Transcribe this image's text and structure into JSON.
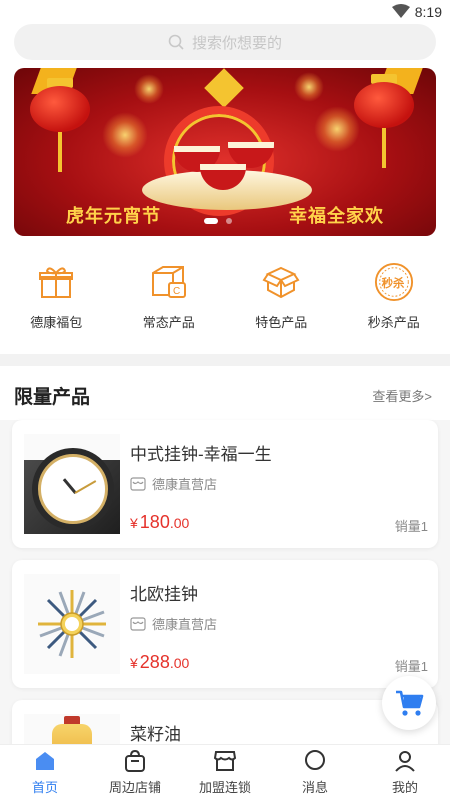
{
  "status_bar": {
    "time": "8:19"
  },
  "search": {
    "placeholder": "搜索你想要的"
  },
  "banner": {
    "caption_left": "虎年元宵节",
    "caption_right": "幸福全家欢",
    "center_glyph": "福",
    "slide_count": 3,
    "active_slide": 0
  },
  "categories": [
    {
      "label": "德康福包",
      "icon": "gift-icon"
    },
    {
      "label": "常态产品",
      "icon": "box-c-icon"
    },
    {
      "label": "特色产品",
      "icon": "package-open-icon"
    },
    {
      "label": "秒杀产品",
      "icon": "flash-sale-icon",
      "icon_text": "秒杀"
    }
  ],
  "limited": {
    "title": "限量产品",
    "more": "查看更多>",
    "products": [
      {
        "name": "中式挂钟-幸福一生",
        "store": "德康直营店",
        "currency": "¥",
        "price_int": "180",
        "price_dec": ".00",
        "sold": "销量1"
      },
      {
        "name": "北欧挂钟",
        "store": "德康直营店",
        "currency": "¥",
        "price_int": "288",
        "price_dec": ".00",
        "sold": "销量1"
      },
      {
        "name": "菜籽油",
        "store": "",
        "currency": "",
        "price_int": "",
        "price_dec": "",
        "sold": ""
      }
    ]
  },
  "bottom_nav": [
    {
      "label": "首页",
      "icon": "home-icon",
      "active": true
    },
    {
      "label": "周边店铺",
      "icon": "shopping-bag-icon",
      "active": false
    },
    {
      "label": "加盟连锁",
      "icon": "store-icon",
      "active": false
    },
    {
      "label": "消息",
      "icon": "message-icon",
      "active": false
    },
    {
      "label": "我的",
      "icon": "user-icon",
      "active": false
    }
  ],
  "colors": {
    "accent": "#2f7ef0",
    "price": "#e5322b",
    "category_icon": "#f0922b"
  }
}
